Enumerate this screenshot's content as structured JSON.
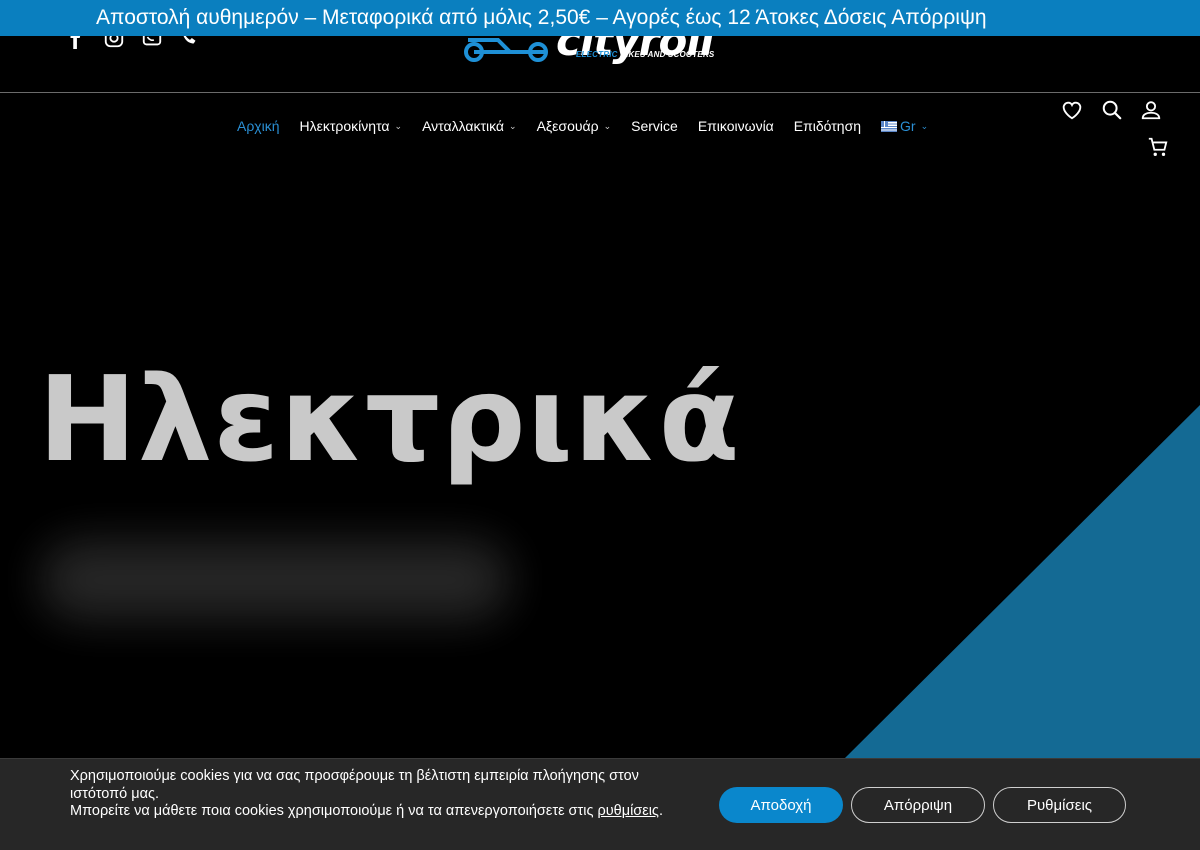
{
  "announcement": "Αποστολή αυθημερόν – Μεταφορικά από μόλις 2,50€ – Αγορές έως 12 Άτοκες Δόσεις Απόρριψη",
  "logo": {
    "word": "cityroll",
    "tag_left": "ELECTRIC",
    "tag_right": "BIKES AND SCOOTERS"
  },
  "socials": [
    "facebook-icon",
    "instagram-icon",
    "whatsapp-icon",
    "phone-icon"
  ],
  "nav": {
    "items": [
      {
        "label": "Αρχική",
        "active": true,
        "dropdown": false
      },
      {
        "label": "Ηλεκτροκίνητα",
        "active": false,
        "dropdown": true
      },
      {
        "label": "Ανταλλακτικά",
        "active": false,
        "dropdown": true
      },
      {
        "label": "Αξεσουάρ",
        "active": false,
        "dropdown": true
      },
      {
        "label": "Service",
        "active": false,
        "dropdown": false
      },
      {
        "label": "Επικοινωνία",
        "active": false,
        "dropdown": false
      },
      {
        "label": "Επιδότηση",
        "active": false,
        "dropdown": false
      }
    ],
    "language": "Gr"
  },
  "tools": [
    "heart-icon",
    "search-icon",
    "user-icon",
    "cart-icon"
  ],
  "hero": {
    "title": "Ηλεκτρικά"
  },
  "cookie": {
    "line1": "Χρησιμοποιούμε cookies για να σας προσφέρουμε τη βέλτιστη εμπειρία πλοήγησης στον ιστότοπό μας.",
    "line2_start": "Μπορείτε να μάθετε ποια cookies χρησιμοποιούμε ή να τα απενεργοποιήσετε στις ",
    "line2_link": "ρυθμίσεις",
    "line2_end": ".",
    "accept": "Αποδοχή",
    "reject": "Απόρριψη",
    "settings": "Ρυθμίσεις"
  },
  "colors": {
    "accent": "#0a7fbf",
    "hero_triangle": "#146a94",
    "active_nav": "#2a8fd4"
  }
}
